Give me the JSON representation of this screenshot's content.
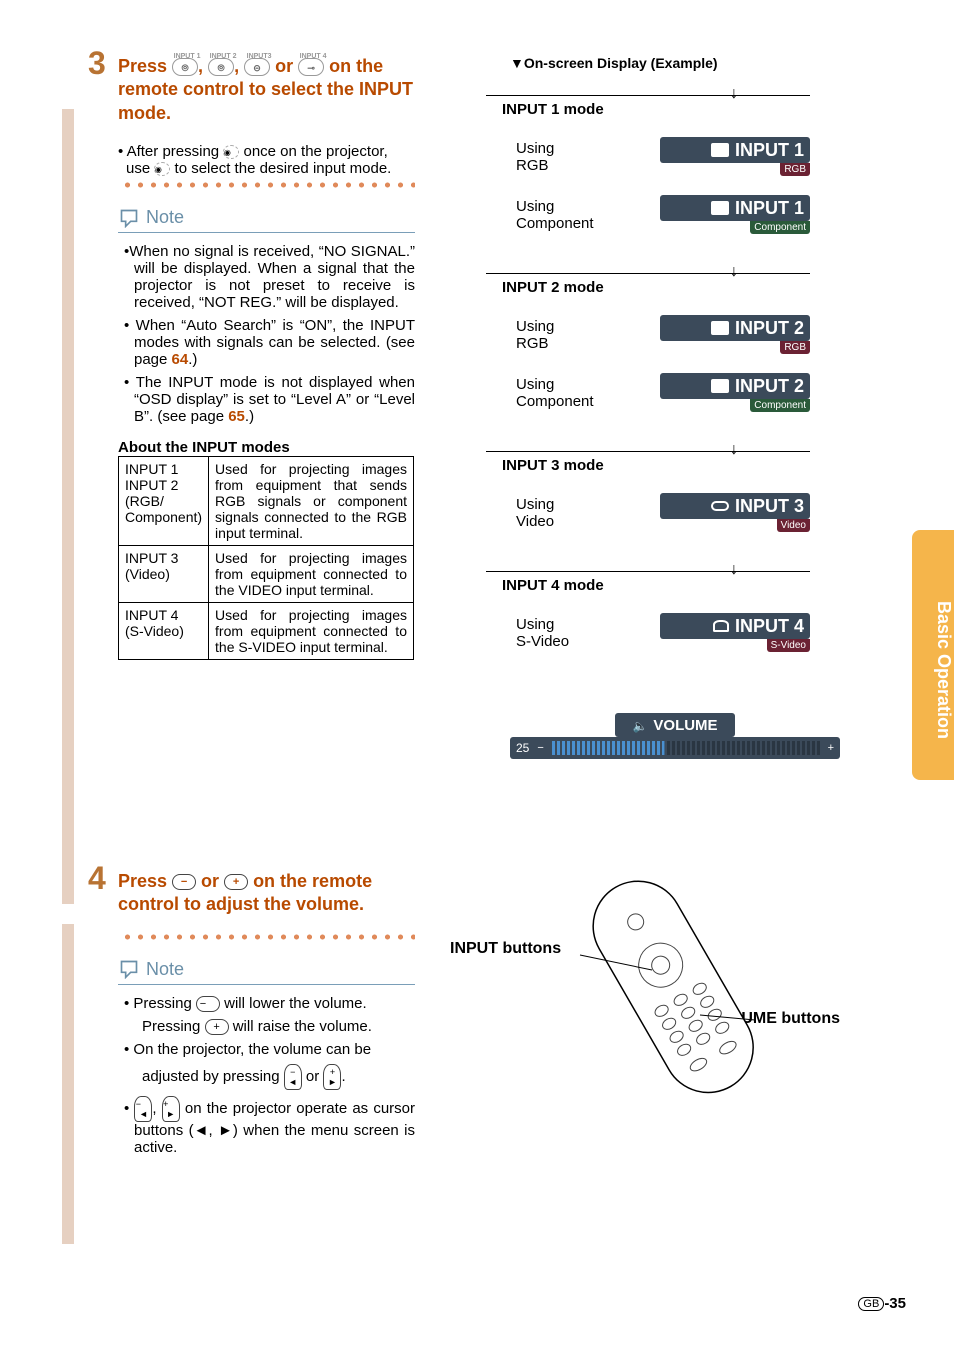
{
  "sideTab": "Basic Operation",
  "step3": {
    "num": "3",
    "title_pre": "Press ",
    "btnLabels": [
      "INPUT 1",
      "INPUT 2",
      "INPUT3",
      "INPUT 4"
    ],
    "title_mid1": ", ",
    "title_mid2": ", ",
    "title_mid3": " or ",
    "title_post": " on the remote control to select the INPUT mode.",
    "afterPressing_a": "After pressing ",
    "afterPressing_b": " once on the projector, use ",
    "afterPressing_c": " to select the desired input mode.",
    "noteTitle": "Note",
    "notes": [
      {
        "t": "When no signal is received, “NO SIGNAL.” will be displayed. When a signal that the projector is not preset to receive is received, “NOT REG.” will be displayed."
      },
      {
        "t": "When “Auto Search” is “ON”, the INPUT modes with signals can be selected. (see page ",
        "link": "64",
        "tail": ".)"
      },
      {
        "t": "The INPUT mode is not displayed when “OSD display” is set to “Level A” or “Level B”. (see page ",
        "link": "65",
        "tail": ".)"
      }
    ],
    "tableCaption": "About the INPUT modes",
    "table": [
      {
        "c1": "INPUT 1\nINPUT 2\n(RGB/\nComponent)",
        "c2": "Used for projecting images from equipment that sends RGB signals or component signals connected to the RGB input terminal."
      },
      {
        "c1": "INPUT 3\n(Video)",
        "c2": "Used for projecting images from equipment connected to the VIDEO input terminal."
      },
      {
        "c1": "INPUT 4\n(S-Video)",
        "c2": "Used for projecting images from equipment connected to the S-VIDEO input terminal."
      }
    ]
  },
  "step4": {
    "num": "4",
    "title_pre": "Press ",
    "title_or": " or ",
    "title_post": " on the remote control to adjust the volume.",
    "noteTitle": "Note",
    "lines": {
      "l1a": "Pressing ",
      "l1b": " will lower the volume.",
      "l2a": "Pressing ",
      "l2b": " will raise the volume.",
      "l3": "On the projector, the volume can be",
      "l4a": "adjusted by pressing ",
      "l4b": " or ",
      "l4c": ".",
      "l5a": ", ",
      "l5b": " on the projector operate as cursor buttons (",
      "l5c": ", ",
      "l5d": ") when the menu screen is active."
    }
  },
  "osd": {
    "title": "On-screen Display (Example)",
    "modes": [
      {
        "label": "INPUT 1 mode",
        "rows": [
          {
            "desc": "Using RGB",
            "badge": "INPUT 1",
            "sub": "RGB",
            "subClass": "darkred",
            "icon": "mon"
          },
          {
            "desc": "Using Component",
            "badge": "INPUT 1",
            "sub": "Component",
            "subClass": "darkgreen",
            "icon": "mon"
          }
        ]
      },
      {
        "label": "INPUT 2 mode",
        "rows": [
          {
            "desc": "Using RGB",
            "badge": "INPUT 2",
            "sub": "RGB",
            "subClass": "darkred",
            "icon": "mon"
          },
          {
            "desc": "Using Component",
            "badge": "INPUT 2",
            "sub": "Component",
            "subClass": "darkgreen",
            "icon": "mon"
          }
        ]
      },
      {
        "label": "INPUT 3 mode",
        "rows": [
          {
            "desc": "Using Video",
            "badge": "INPUT 3",
            "sub": "Video",
            "subClass": "darkred",
            "icon": "video"
          }
        ]
      },
      {
        "label": "INPUT 4 mode",
        "rows": [
          {
            "desc": "Using S-Video",
            "badge": "INPUT 4",
            "sub": "S-Video",
            "subClass": "darkred",
            "icon": "svideo"
          }
        ]
      }
    ],
    "volume": {
      "label": "VOLUME",
      "value": "25"
    }
  },
  "remote": {
    "inputLabel": "INPUT buttons",
    "volLabel": "VOLUME buttons"
  },
  "pageNum": {
    "region": "GB",
    "num": "-35"
  }
}
